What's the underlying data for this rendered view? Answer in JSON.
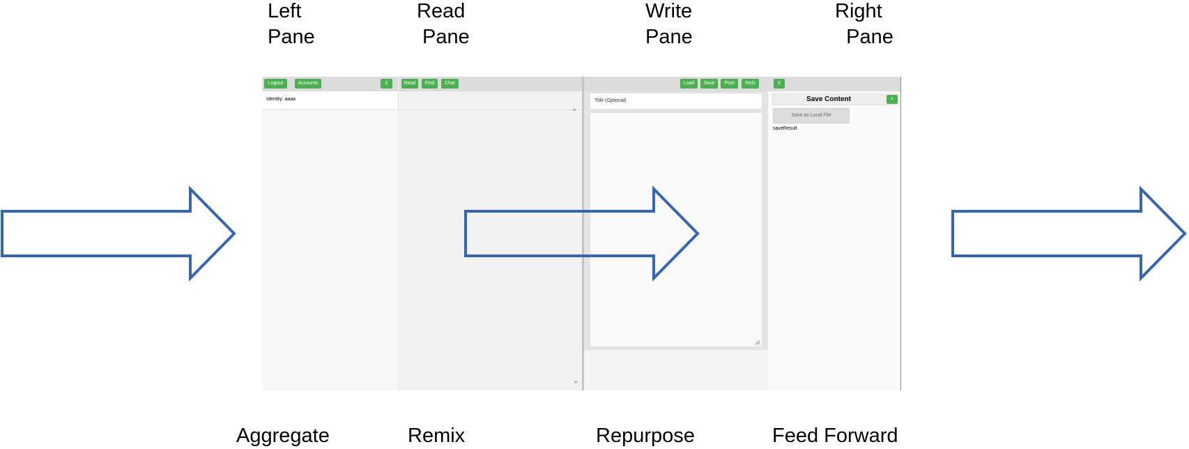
{
  "labels": {
    "top": [
      "Left\nPane",
      "Read\n Pane",
      "Write\nPane",
      "Right\n  Pane"
    ],
    "bottom": [
      "Aggregate",
      "Remix",
      "Repurpose",
      "Feed Forward"
    ]
  },
  "left_pane": {
    "logout": "Logout",
    "accounts": "Accounts",
    "close": "X",
    "identity": "Identity: aaaa"
  },
  "read_pane": {
    "read": "Read",
    "find": "Find",
    "chat": "Chat",
    "scroll_up": "^",
    "scroll_down": "⌄"
  },
  "write_pane": {
    "load": "Load",
    "save": "Save",
    "post": "Post",
    "refs": "Refs",
    "title_placeholder": "Title (Optional)"
  },
  "right_pane": {
    "close": "X",
    "heading": "Save Content",
    "heading_close": "×",
    "save_local": "Save as Local File",
    "result": "saveResult"
  },
  "colors": {
    "button_green": "#4caf50",
    "arrow_blue": "#3566b5"
  }
}
